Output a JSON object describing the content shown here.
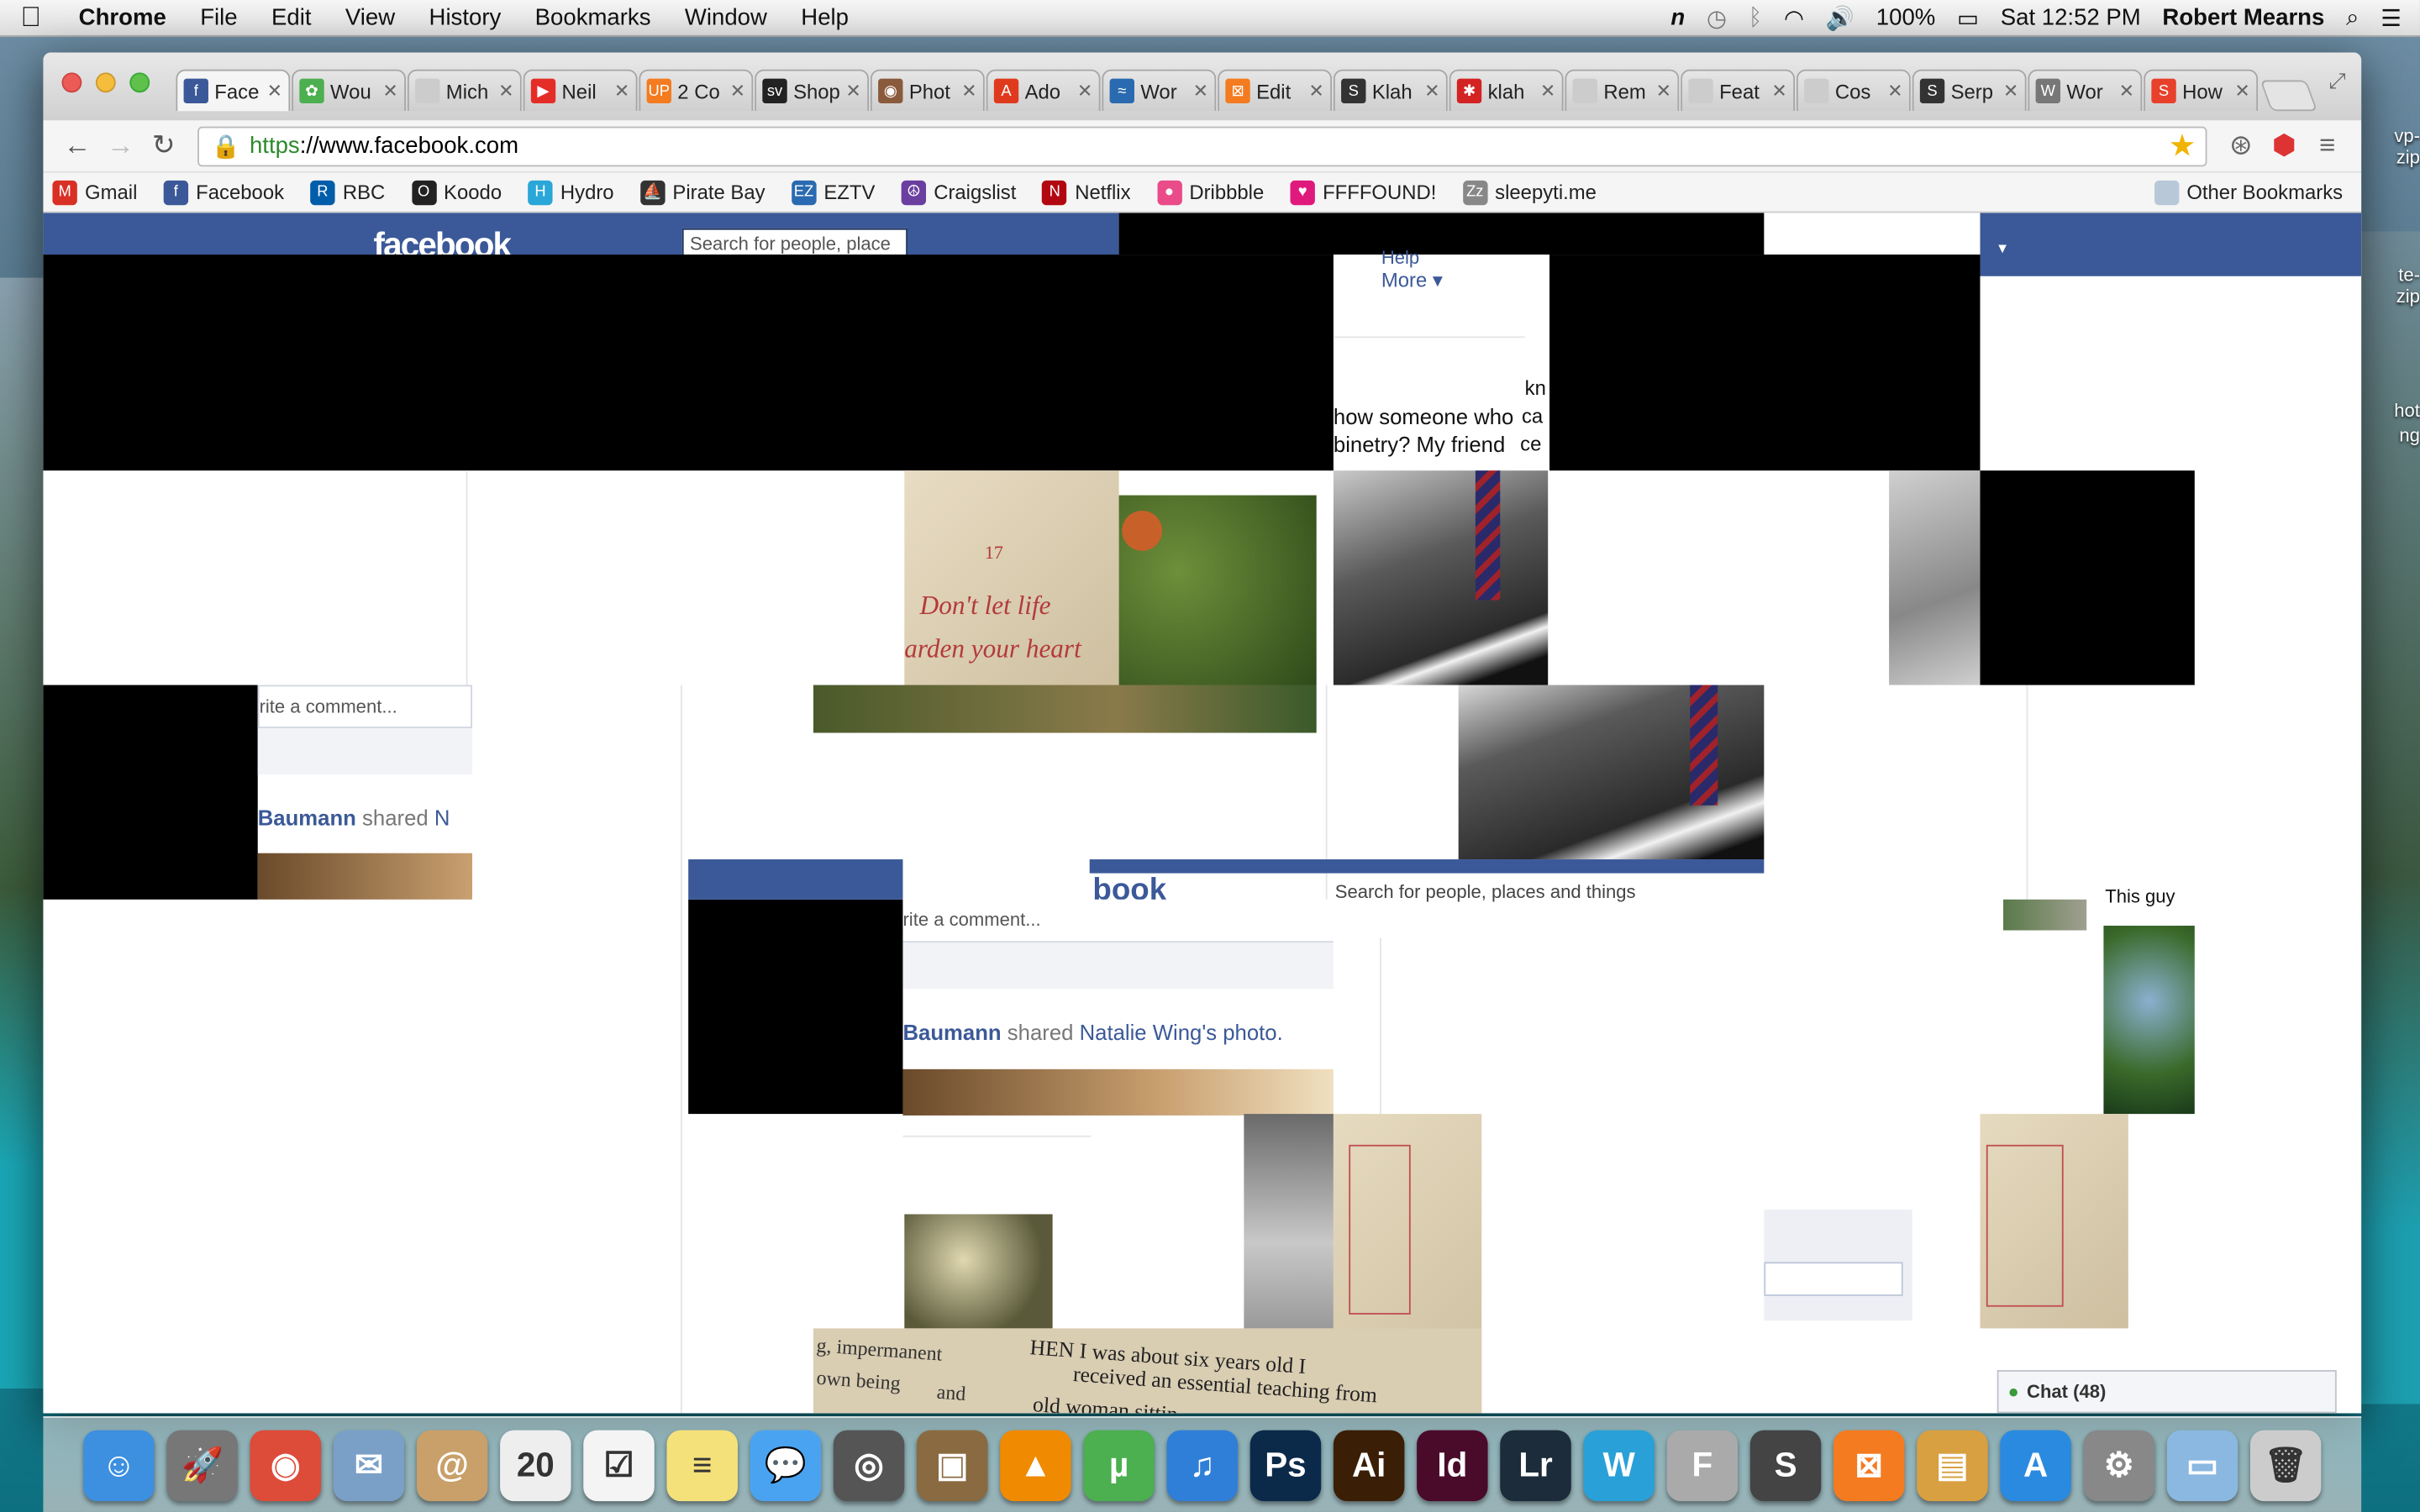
{
  "menubar": {
    "app": "Chrome",
    "items": [
      "File",
      "Edit",
      "View",
      "History",
      "Bookmarks",
      "Window",
      "Help"
    ],
    "battery": "100%",
    "clock": "Sat 12:52 PM",
    "user": "Robert Mearns"
  },
  "tabs": [
    {
      "label": "Face",
      "icon": "facebook-icon",
      "color": "#3b5998",
      "glyph": "f"
    },
    {
      "label": "Wou",
      "icon": "leaf-icon",
      "color": "#4caf50",
      "glyph": "✿"
    },
    {
      "label": "Mich",
      "icon": "page-icon",
      "color": "#cccccc",
      "glyph": ""
    },
    {
      "label": "Neil",
      "icon": "youtube-icon",
      "color": "#e52d27",
      "glyph": "▶"
    },
    {
      "label": "2 Co",
      "icon": "up-icon",
      "color": "#f47b20",
      "glyph": "UP"
    },
    {
      "label": "Shop",
      "icon": "sv-icon",
      "color": "#222222",
      "glyph": "sv"
    },
    {
      "label": "Phot",
      "icon": "instagram-icon",
      "color": "#8a5a3c",
      "glyph": "◉"
    },
    {
      "label": "Ado",
      "icon": "adobe-icon",
      "color": "#e03a1e",
      "glyph": "A"
    },
    {
      "label": "Wor",
      "icon": "runner-icon",
      "color": "#2a6ab0",
      "glyph": "≈"
    },
    {
      "label": "Edit",
      "icon": "xampp-icon",
      "color": "#f47b20",
      "glyph": "⊠"
    },
    {
      "label": "Klah",
      "icon": "klah-icon",
      "color": "#333333",
      "glyph": "S"
    },
    {
      "label": "klah",
      "icon": "yelp-icon",
      "color": "#d32323",
      "glyph": "✱"
    },
    {
      "label": "Rem",
      "icon": "page-icon",
      "color": "#cccccc",
      "glyph": ""
    },
    {
      "label": "Feat",
      "icon": "page-icon",
      "color": "#cccccc",
      "glyph": ""
    },
    {
      "label": "Cos",
      "icon": "page-icon",
      "color": "#cccccc",
      "glyph": ""
    },
    {
      "label": "Serp",
      "icon": "serp-icon",
      "color": "#333333",
      "glyph": "S"
    },
    {
      "label": "Wor",
      "icon": "wordpress-icon",
      "color": "#777777",
      "glyph": "W"
    },
    {
      "label": "How",
      "icon": "stumble-icon",
      "color": "#e8412b",
      "glyph": "S"
    }
  ],
  "omnibox": {
    "scheme": "https",
    "rest": "://www.facebook.com"
  },
  "bookmarks": [
    {
      "label": "Gmail",
      "icon": "gmail-icon",
      "color": "#d93025",
      "glyph": "M"
    },
    {
      "label": "Facebook",
      "icon": "facebook-icon",
      "color": "#3b5998",
      "glyph": "f"
    },
    {
      "label": "RBC",
      "icon": "rbc-icon",
      "color": "#005daa",
      "glyph": "R"
    },
    {
      "label": "Koodo",
      "icon": "koodo-icon",
      "color": "#222222",
      "glyph": "O"
    },
    {
      "label": "Hydro",
      "icon": "hydro-icon",
      "color": "#2aa7d8",
      "glyph": "H"
    },
    {
      "label": "Pirate Bay",
      "icon": "ship-icon",
      "color": "#333333",
      "glyph": "⛵"
    },
    {
      "label": "EZTV",
      "icon": "eztv-icon",
      "color": "#2a6ab0",
      "glyph": "EZ"
    },
    {
      "label": "Craigslist",
      "icon": "peace-icon",
      "color": "#6a3fa0",
      "glyph": "☮"
    },
    {
      "label": "Netflix",
      "icon": "netflix-icon",
      "color": "#b20710",
      "glyph": "N"
    },
    {
      "label": "Dribbble",
      "icon": "dribbble-icon",
      "color": "#ea4c89",
      "glyph": "●"
    },
    {
      "label": "FFFFOUND!",
      "icon": "heart-icon",
      "color": "#e0197d",
      "glyph": "♥"
    },
    {
      "label": "sleepyti.me",
      "icon": "zzz-icon",
      "color": "#888888",
      "glyph": "Zz"
    }
  ],
  "other_bookmarks": "Other Bookmarks",
  "facebook": {
    "logo": "facebook",
    "search_placeholder": "Search for people, places and things",
    "search_placeholder_short": "Search for people, place",
    "help": "Help",
    "more": "More ▾",
    "text_kn": "kn",
    "text_ca": "ca",
    "text_ce": "ce",
    "snippet1": "how someone who",
    "snippet2": "binetry? My friend",
    "comment_placeholder": "rite a comment...",
    "comment_placeholder2": "rite a comment...",
    "shared1_name": "Baumann",
    "shared1_verb": "shared",
    "shared1_obj": "N",
    "shared2_name": "Baumann",
    "shared2_verb": "shared",
    "shared2_obj": "Natalie Wing's photo.",
    "this_guy": "This guy",
    "book_num": "17",
    "book_line1": "Don't let life",
    "book_line2": "arden your heart",
    "book_text1": "HEN I was about six years old I",
    "book_text2": "received an essential teaching from",
    "book_text3": "old woman sittin",
    "book_left1": "g, impermanent",
    "book_left2": "own being",
    "book_left3": "and",
    "logo_frag": "book",
    "chat": "Chat (48)"
  },
  "desktop_files": [
    "vp-",
    "zip",
    "te-",
    "zip",
    "hot",
    "ng"
  ],
  "dock": [
    {
      "name": "finder-icon",
      "color": "#3d8fe0",
      "glyph": "☺"
    },
    {
      "name": "launchpad-icon",
      "color": "#777777",
      "glyph": "🚀"
    },
    {
      "name": "chrome-icon",
      "color": "#dd4b39",
      "glyph": "◉"
    },
    {
      "name": "mail-icon",
      "color": "#7aa0c8",
      "glyph": "✉"
    },
    {
      "name": "contacts-icon",
      "color": "#c9a06a",
      "glyph": "@"
    },
    {
      "name": "calendar-icon",
      "color": "#eeeeee",
      "glyph": "20"
    },
    {
      "name": "reminders-icon",
      "color": "#f4f4f4",
      "glyph": "☑"
    },
    {
      "name": "notes-icon",
      "color": "#f5e17a",
      "glyph": "≡"
    },
    {
      "name": "messages-icon",
      "color": "#4aa3f0",
      "glyph": "💬"
    },
    {
      "name": "facetime-icon",
      "color": "#555555",
      "glyph": "◎"
    },
    {
      "name": "iphoto-icon",
      "color": "#8a6a40",
      "glyph": "▣"
    },
    {
      "name": "vlc-icon",
      "color": "#f08a00",
      "glyph": "▲"
    },
    {
      "name": "utorrent-icon",
      "color": "#4caf50",
      "glyph": "µ"
    },
    {
      "name": "itunes-icon",
      "color": "#2f7fd8",
      "glyph": "♫"
    },
    {
      "name": "photoshop-icon",
      "color": "#0b2a4a",
      "glyph": "Ps"
    },
    {
      "name": "illustrator-icon",
      "color": "#3a1e05",
      "glyph": "Ai"
    },
    {
      "name": "indesign-icon",
      "color": "#4a0b2a",
      "glyph": "Id"
    },
    {
      "name": "lightroom-icon",
      "color": "#1c2c3a",
      "glyph": "Lr"
    },
    {
      "name": "wordpress-app-icon",
      "color": "#2aa0d8",
      "glyph": "W"
    },
    {
      "name": "fontbook-icon",
      "color": "#aaaaaa",
      "glyph": "F"
    },
    {
      "name": "sublime-icon",
      "color": "#444444",
      "glyph": "S"
    },
    {
      "name": "xampp-icon",
      "color": "#f47b20",
      "glyph": "⊠"
    },
    {
      "name": "transmit-icon",
      "color": "#d8a040",
      "glyph": "▤"
    },
    {
      "name": "appstore-icon",
      "color": "#2a8ae0",
      "glyph": "A"
    },
    {
      "name": "system-preferences-icon",
      "color": "#888888",
      "glyph": "⚙"
    },
    {
      "name": "folder-icon",
      "color": "#8ab8e0",
      "glyph": "▭"
    },
    {
      "name": "trash-icon",
      "color": "#cccccc",
      "glyph": "🗑"
    }
  ]
}
